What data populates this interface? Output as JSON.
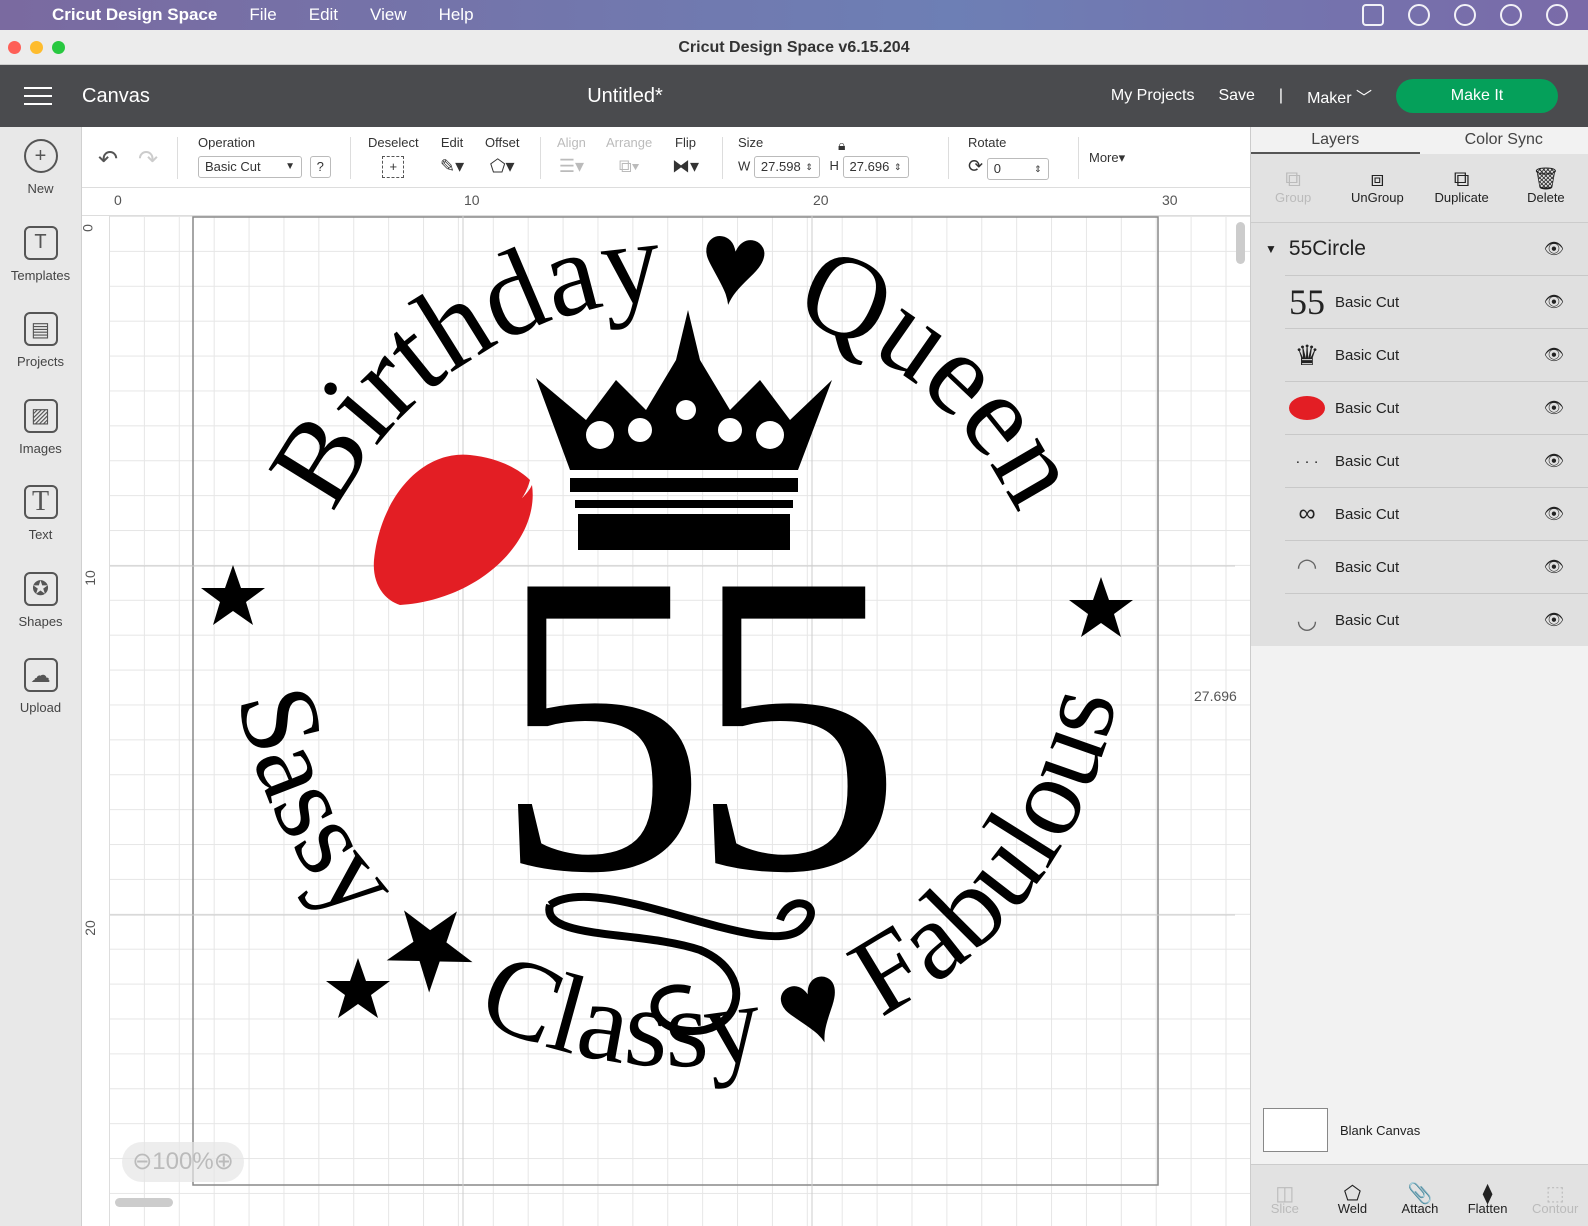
{
  "menubar": {
    "app": "Cricut Design Space",
    "items": [
      "File",
      "Edit",
      "View",
      "Help"
    ]
  },
  "window": {
    "title": "Cricut Design Space  v6.15.204"
  },
  "header": {
    "section": "Canvas",
    "document": "Untitled*",
    "my_projects": "My Projects",
    "save": "Save",
    "divider": "|",
    "machine": "Maker",
    "make_it": "Make It"
  },
  "sidebar": {
    "items": [
      {
        "label": "New",
        "icon": "+"
      },
      {
        "label": "Templates",
        "icon": "T"
      },
      {
        "label": "Projects",
        "icon": "▤"
      },
      {
        "label": "Images",
        "icon": "▨"
      },
      {
        "label": "Text",
        "icon": "T"
      },
      {
        "label": "Shapes",
        "icon": "✪"
      },
      {
        "label": "Upload",
        "icon": "☁"
      }
    ]
  },
  "toolbar": {
    "operation_label": "Operation",
    "operation_value": "Basic Cut",
    "help": "?",
    "deselect": "Deselect",
    "edit": "Edit",
    "offset": "Offset",
    "align": "Align",
    "arrange": "Arrange",
    "flip": "Flip",
    "size": "Size",
    "w_label": "W",
    "w_value": "27.598",
    "h_label": "H",
    "h_value": "27.696",
    "rotate": "Rotate",
    "rotate_value": "0",
    "more": "More▾"
  },
  "ruler": {
    "h": [
      "0",
      "10",
      "20",
      "30"
    ],
    "v": [
      "0",
      "10",
      "20"
    ]
  },
  "canvas": {
    "height_readout": "27.696",
    "zoom": "100%",
    "design": {
      "top_text": "Birthday ♥ Queen",
      "bottom_text": "Sassy ★ Classy ♥ Fabulous",
      "number": "55"
    },
    "colors": {
      "lips": "#e31e24",
      "ink": "#000000"
    }
  },
  "panel": {
    "tabs": [
      "Layers",
      "Color Sync"
    ],
    "actions": [
      {
        "label": "Group",
        "icon": "⧉",
        "disabled": true
      },
      {
        "label": "UnGroup",
        "icon": "⧈"
      },
      {
        "label": "Duplicate",
        "icon": "⧉"
      },
      {
        "label": "Delete",
        "icon": "🗑"
      }
    ],
    "group": "55Circle",
    "layers": [
      {
        "thumb": "55",
        "label": "Basic Cut"
      },
      {
        "thumb": "♛",
        "label": "Basic Cut"
      },
      {
        "thumb": "lips",
        "label": "Basic Cut"
      },
      {
        "thumb": "· · ·",
        "label": "Basic Cut"
      },
      {
        "thumb": "∞",
        "label": "Basic Cut"
      },
      {
        "thumb": "◠",
        "label": "Basic Cut"
      },
      {
        "thumb": "◡",
        "label": "Basic Cut"
      }
    ],
    "blank_canvas": "Blank Canvas",
    "bottom_actions": [
      {
        "label": "Slice",
        "icon": "◫",
        "disabled": true
      },
      {
        "label": "Weld",
        "icon": "⬠"
      },
      {
        "label": "Attach",
        "icon": "📎"
      },
      {
        "label": "Flatten",
        "icon": "⧫"
      },
      {
        "label": "Contour",
        "icon": "⬚",
        "disabled": true
      }
    ]
  }
}
